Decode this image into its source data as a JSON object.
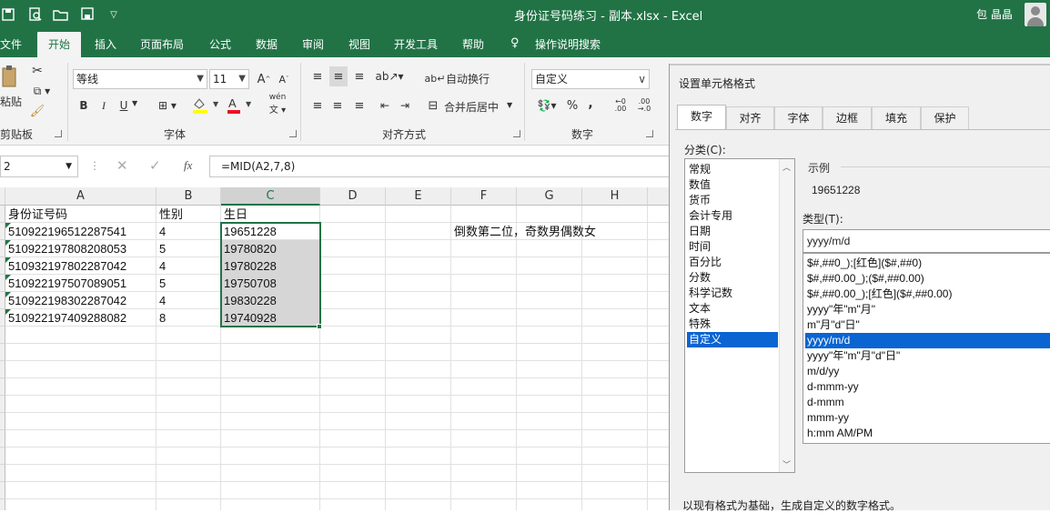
{
  "titlebar": {
    "title": "身份证号码练习 - 副本.xlsx  -  Excel",
    "user": "包 晶晶"
  },
  "ribbon_tabs": [
    "文件",
    "开始",
    "插入",
    "页面布局",
    "公式",
    "数据",
    "审阅",
    "视图",
    "开发工具",
    "帮助",
    "操作说明搜索"
  ],
  "ribbon": {
    "paste_label": "粘贴",
    "clipboard_label": "剪贴板",
    "font_name": "等线",
    "font_size": "11",
    "font_group_label": "字体",
    "bold": "B",
    "italic": "I",
    "underline": "U",
    "wen": "wén",
    "wrap_text": "自动换行",
    "merge_center": "合并后居中",
    "align_group_label": "对齐方式",
    "number_format": "自定义",
    "percent": "%",
    "comma": ",",
    "number_group_label": "数字",
    "font_color": "#e81123",
    "highlight_color": "#ffff00"
  },
  "formula_bar": {
    "name_box": "2",
    "fx": "fx",
    "formula": "=MID(A2,7,8)"
  },
  "columns": [
    "A",
    "B",
    "C",
    "D",
    "E",
    "F",
    "G",
    "H"
  ],
  "sheet": {
    "header_row": [
      "身份证号码",
      "性别",
      "生日"
    ],
    "rows": [
      [
        "510922196512287541",
        "4",
        "19651228"
      ],
      [
        "510922197808208053",
        "5",
        "19780820"
      ],
      [
        "510932197802287042",
        "4",
        "19780228"
      ],
      [
        "510922197507089051",
        "5",
        "19750708"
      ],
      [
        "510922198302287042",
        "4",
        "19830228"
      ],
      [
        "510922197409288082",
        "8",
        "19740928"
      ]
    ],
    "note": "倒数第二位，奇数男偶数女"
  },
  "dialog": {
    "title": "设置单元格格式",
    "tabs": [
      "数字",
      "对齐",
      "字体",
      "边框",
      "填充",
      "保护"
    ],
    "active_tab": "数字",
    "category_label": "分类(C):",
    "categories": [
      "常规",
      "数值",
      "货币",
      "会计专用",
      "日期",
      "时间",
      "百分比",
      "分数",
      "科学记数",
      "文本",
      "特殊",
      "自定义"
    ],
    "selected_category": "自定义",
    "sample_label": "示例",
    "sample_value": "19651228",
    "type_label": "类型(T):",
    "type_value": "yyyy/m/d",
    "formats": [
      "$#,##0_);[红色]($#,##0)",
      "$#,##0.00_);($#,##0.00)",
      "$#,##0.00_);[红色]($#,##0.00)",
      "yyyy\"年\"m\"月\"",
      "m\"月\"d\"日\"",
      "yyyy/m/d",
      "yyyy\"年\"m\"月\"d\"日\"",
      "m/d/yy",
      "d-mmm-yy",
      "d-mmm",
      "mmm-yy",
      "h:mm AM/PM"
    ],
    "selected_format": "yyyy/m/d",
    "hint": "以现有格式为基础，生成自定义的数字格式。"
  }
}
